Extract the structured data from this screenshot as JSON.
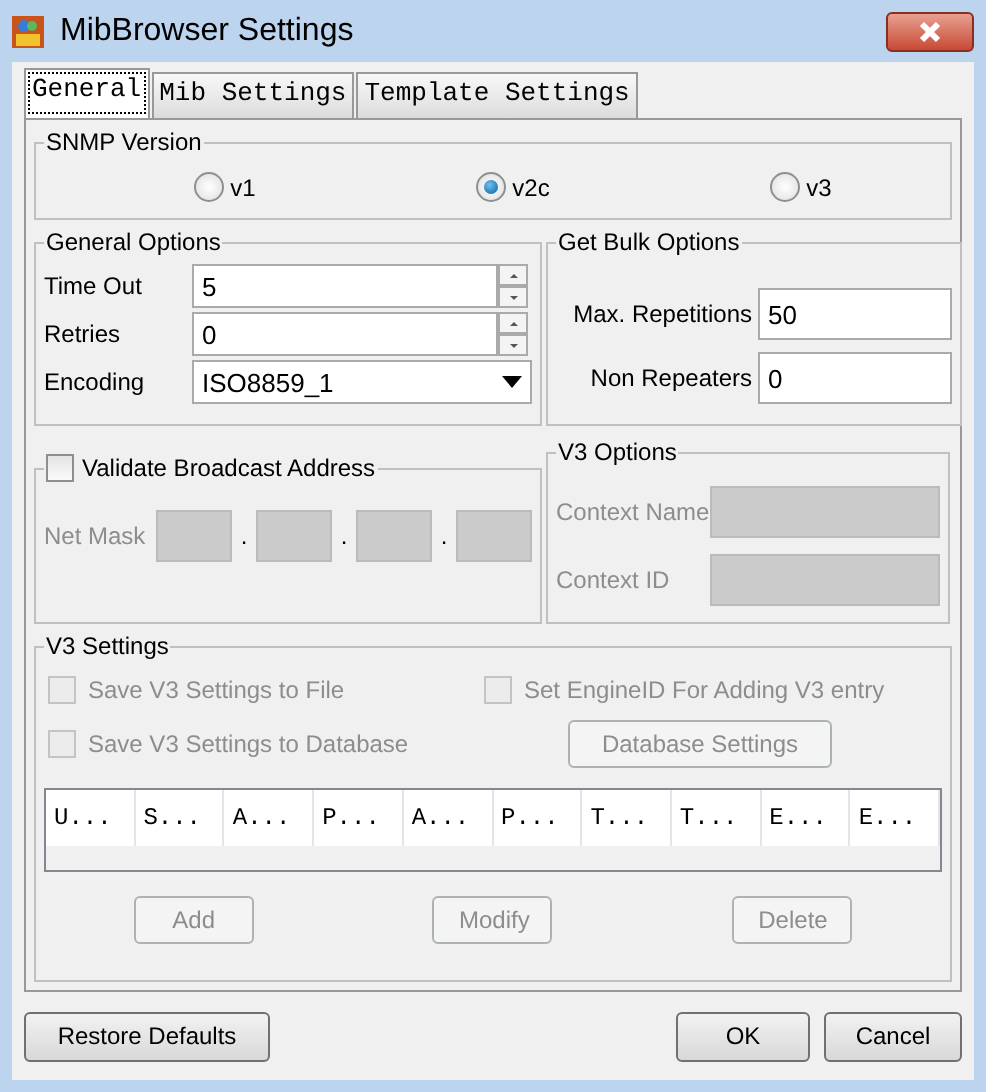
{
  "window": {
    "title": "MibBrowser Settings"
  },
  "tabs": [
    {
      "label": "General",
      "selected": true
    },
    {
      "label": "Mib Settings",
      "selected": false
    },
    {
      "label": "Template Settings",
      "selected": false
    }
  ],
  "snmp_version": {
    "title": "SNMP Version",
    "options": [
      {
        "label": "v1",
        "selected": false
      },
      {
        "label": "v2c",
        "selected": true
      },
      {
        "label": "v3",
        "selected": false
      }
    ]
  },
  "general_options": {
    "title": "General Options",
    "fields": [
      {
        "kind": "spinner",
        "label": "Time Out",
        "value": "5"
      },
      {
        "kind": "spinner",
        "label": "Retries",
        "value": "0"
      },
      {
        "kind": "dropdown",
        "label": "Encoding",
        "value": "ISO8859_1"
      }
    ]
  },
  "get_bulk_options": {
    "title": "Get Bulk Options",
    "fields": [
      {
        "label": "Max. Repetitions",
        "value": "50"
      },
      {
        "label": "Non Repeaters",
        "value": "0"
      }
    ]
  },
  "broadcast": {
    "label": "Validate Broadcast Address",
    "checked": false,
    "net_mask_label": "Net Mask",
    "separators": [
      ".",
      ".",
      "."
    ],
    "disabled": true
  },
  "v3_options": {
    "title": "V3 Options",
    "disabled": true,
    "fields": [
      {
        "label": "Context Name"
      },
      {
        "label": "Context ID"
      }
    ]
  },
  "v3_settings": {
    "title": "V3 Settings",
    "checkboxes": [
      {
        "label": "Save V3 Settings to File",
        "checked": false,
        "disabled": true
      },
      {
        "label": "Set EngineID For Adding V3 entry",
        "checked": false,
        "disabled": true
      },
      {
        "label": "Save V3 Settings to Database",
        "checked": false,
        "disabled": true
      }
    ],
    "database_button": {
      "label": "Database Settings",
      "disabled": true
    },
    "table": {
      "columns": [
        "U...",
        "S...",
        "A...",
        "P...",
        "A...",
        "P...",
        "T...",
        "T...",
        "E...",
        "E..."
      ]
    },
    "buttons": [
      {
        "label": "Add",
        "disabled": true
      },
      {
        "label": "Modify",
        "disabled": true
      },
      {
        "label": "Delete",
        "disabled": true
      }
    ]
  },
  "footer": {
    "left_button": "Restore Defaults",
    "buttons": [
      "OK",
      "Cancel"
    ]
  }
}
